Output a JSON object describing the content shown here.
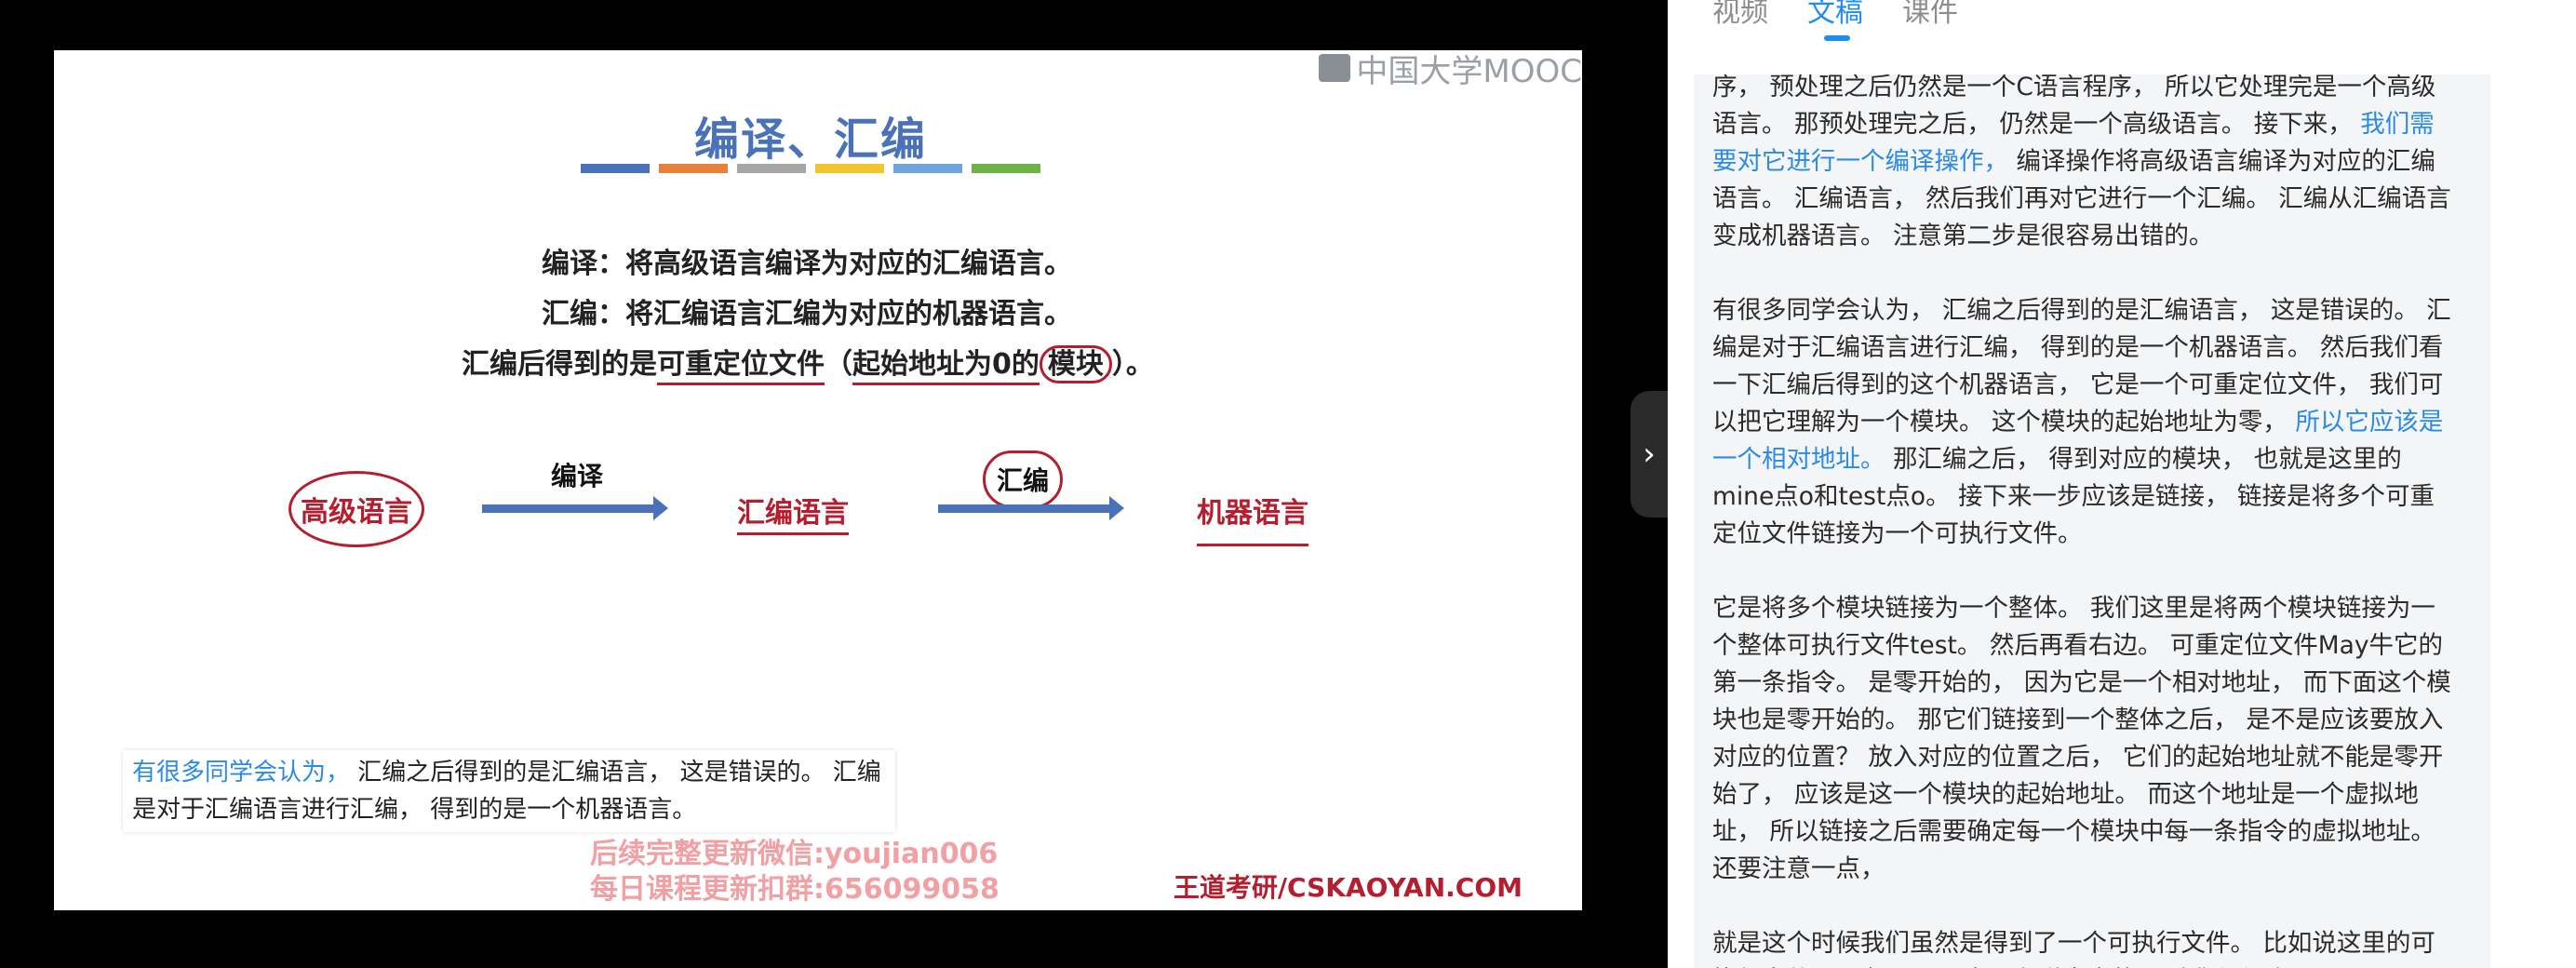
{
  "video": {
    "watermark_logo": "中国大学MOOC",
    "slide": {
      "title": "编译、汇编",
      "title_bar_colors": [
        "#4a72b8",
        "#e8823a",
        "#a6a6a6",
        "#f2c52c",
        "#6ea6dc",
        "#6fb24a"
      ],
      "line1": "编译：将高级语言编译为对应的汇编语言。",
      "line2": "汇编：将汇编语言汇编为对应的机器语言。",
      "line3_a": "汇编后得到的是",
      "line3_b": "可重定位文件",
      "line3_c": "（",
      "line3_d": "起始地址为0的",
      "line3_e": "模块",
      "line3_f": "）。",
      "flow": {
        "node1": "高级语言",
        "arrow1": "编译",
        "node2": "汇编语言",
        "arrow2": "汇编",
        "node3": "机器语言"
      },
      "promo1": "后续完整更新微信:youjian006",
      "promo2": "每日课程更新扣群:656099058",
      "brand": "王道考研/CSKAOYAN.COM"
    },
    "subtitle": {
      "highlight": "有很多同学会认为，",
      "rest": "汇编之后得到的是汇编语言， 这是错误的。 汇编是对于汇编语言进行汇编， 得到的是一个机器语言。"
    }
  },
  "panel": {
    "tabs": [
      "视频",
      "文稿",
      "课件"
    ],
    "active_tab": "文稿",
    "accent": "#1f8cf0",
    "paragraphs": [
      {
        "a": "序， 预处理之后仍然是一个C语言程序， 所以它处理完是一个高级语言。 那预处理完之后， 仍然是一个高级语言。 接下来，",
        "hl": "我们需要对它进行一个编译操作，",
        "b": "编译操作将高级语言编译为对应的汇编语言。 汇编语言， 然后我们再对它进行一个汇编。 汇编从汇编语言变成机器语言。 注意第二步是很容易出错的。"
      },
      {
        "a": "有很多同学会认为， 汇编之后得到的是汇编语言， 这是错误的。 汇编是对于汇编语言进行汇编， 得到的是一个机器语言。 然后我们看一下汇编后得到的这个机器语言， 它是一个可重定位文件， 我们可以把它理解为一个模块。 这个模块的起始地址为零，",
        "hl": "所以它应该是一个相对地址。",
        "b": "那汇编之后， 得到对应的模块， 也就是这里的mine点o和test点o。 接下来一步应该是链接， 链接是将多个可重定位文件链接为一个可执行文件。"
      },
      {
        "a": "它是将多个模块链接为一个整体。 我们这里是将两个模块链接为一个整体可执行文件test。 然后再看右边。 可重定位文件May牛它的第一条指令。 是零开始的， 因为它是一个相对地址， 而下面这个模块也是零开始的。 那它们链接到一个整体之后， 是不是应该要放入对应的位置？ 放入对应的位置之后， 它们的起始地址就不能是零开始了， 应该是这一个模块的起始地址。 而这个地址是一个虚拟地址， 所以链接之后需要确定每一个模块中每一条指令的虚拟地址。 还要注意一点，",
        "hl": "",
        "b": ""
      },
      {
        "a": "就是这个时候我们虽然是得到了一个可执行文件。 比如说这里的可执行文件test点EXE， 它是在磁盘中的， 我们还没有调入",
        "hl": "",
        "b": ""
      }
    ]
  }
}
